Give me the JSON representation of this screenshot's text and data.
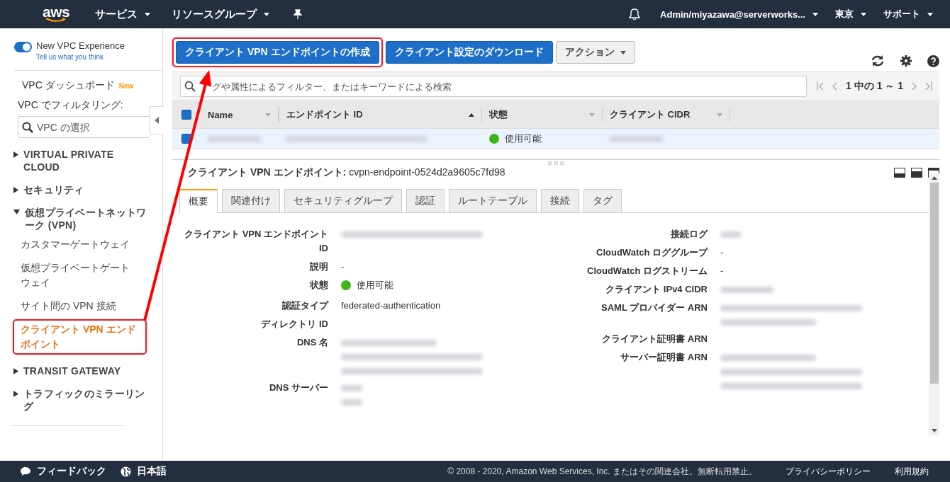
{
  "top_nav": {
    "logo": "aws",
    "menus": [
      {
        "label": "サービス"
      },
      {
        "label": "リソースグループ"
      }
    ],
    "account": "Admin/miyazawa@serverworks...",
    "region": "東京",
    "support": "サポート"
  },
  "sidebar": {
    "toggle": {
      "label": "New VPC Experience",
      "on": true,
      "link": "Tell us what you think"
    },
    "dashboard": {
      "label": "VPC ダッシュボード",
      "badge": "New"
    },
    "filter_label": "VPC でフィルタリング:",
    "vpc_select": {
      "placeholder": "VPC の選択"
    },
    "sections": [
      {
        "label": "VIRTUAL PRIVATE CLOUD",
        "expanded": false
      },
      {
        "label": "セキュリティ",
        "expanded": false
      },
      {
        "label": "仮想プライベートネットワーク (VPN)",
        "expanded": true,
        "children": [
          {
            "label": "カスタマーゲートウェイ",
            "selected": false,
            "highlighted": false
          },
          {
            "label": "仮想プライベートゲートウェイ",
            "selected": false,
            "highlighted": false
          },
          {
            "label": "サイト間の VPN 接続",
            "selected": false,
            "highlighted": false
          },
          {
            "label": "クライアント VPN エンドポイント",
            "selected": true,
            "highlighted": true
          }
        ]
      },
      {
        "label": "TRANSIT GATEWAY",
        "expanded": false
      },
      {
        "label": "トラフィックのミラーリング",
        "expanded": false
      }
    ]
  },
  "toolbar": {
    "buttons": [
      {
        "label": "クライアント VPN エンドポイントの作成",
        "kind": "primary",
        "highlighted": true
      },
      {
        "label": "クライアント設定のダウンロード",
        "kind": "primary",
        "highlighted": false
      },
      {
        "label": "アクション",
        "kind": "dropdown",
        "highlighted": false
      }
    ]
  },
  "filter": {
    "placeholder": "グや属性によるフィルター、またはキーワードによる検索"
  },
  "pagination": "1 中の 1 ～ 1",
  "table": {
    "select_all": {
      "checked": true
    },
    "columns": [
      {
        "label": "Name",
        "sorted": false
      },
      {
        "label": "エンドポイント ID",
        "sorted": true
      },
      {
        "label": "状態",
        "sorted": false
      },
      {
        "label": "クライアント CIDR",
        "sorted": false
      }
    ],
    "rows": [
      {
        "selected": true,
        "cells": [
          {
            "kind": "blurshort"
          },
          {
            "kind": "blurlong"
          },
          {
            "kind": "status",
            "text": "使用可能",
            "color": "#3fb618"
          },
          {
            "kind": "blurshort"
          }
        ]
      }
    ]
  },
  "details": {
    "title_label": "クライアント VPN エンドポイント:",
    "title_value": "cvpn-endpoint-0524d2a9605c7fd98",
    "tabs": [
      {
        "label": "概要",
        "selected": true
      },
      {
        "label": "関連付け",
        "selected": false
      },
      {
        "label": "セキュリティグループ",
        "selected": false
      },
      {
        "label": "認証",
        "selected": false
      },
      {
        "label": "ルートテーブル",
        "selected": false
      },
      {
        "label": "接続",
        "selected": false
      },
      {
        "label": "タグ",
        "selected": false
      }
    ],
    "left_fields": [
      {
        "label": "クライアント VPN エンドポイント ID",
        "value": {
          "kind": "blurlong"
        }
      },
      {
        "label": "説明",
        "value": {
          "kind": "text",
          "text": "-"
        }
      },
      {
        "label": "状態",
        "value": {
          "kind": "status",
          "text": "使用可能",
          "color": "#3fb618"
        }
      },
      {
        "label": "認証タイプ",
        "value": {
          "kind": "text",
          "text": "federated-authentication"
        }
      },
      {
        "label": "ディレクトリ ID"
      },
      {
        "label": "DNS 名",
        "value": {
          "kind": "blurthree"
        }
      },
      {
        "label": "DNS サーバー",
        "value": {
          "kind": "blurtwotiny"
        }
      }
    ],
    "right_fields": [
      {
        "label": "接続ログ",
        "value": {
          "kind": "blurtiny"
        }
      },
      {
        "label": "CloudWatch ロググループ",
        "value": {
          "kind": "text",
          "text": "-"
        }
      },
      {
        "label": "CloudWatch ログストリーム",
        "value": {
          "kind": "text",
          "text": "-"
        }
      },
      {
        "label": "クライアント IPv4 CIDR",
        "value": {
          "kind": "blurshort"
        }
      },
      {
        "label": "SAML プロバイダー ARN",
        "value": {
          "kind": "blurtwo"
        }
      },
      {
        "label": "クライアント証明書 ARN"
      },
      {
        "label": "サーバー証明書 ARN",
        "value": {
          "kind": "blurthree"
        }
      }
    ]
  },
  "arrow": true,
  "footer": {
    "feedback": "フィードバック",
    "language": "日本語",
    "copyright": "© 2008 - 2020, Amazon Web Services, Inc. またはその関連会社。無断転用禁止。",
    "privacy": "プライバシーポリシー",
    "terms": "利用規約"
  }
}
